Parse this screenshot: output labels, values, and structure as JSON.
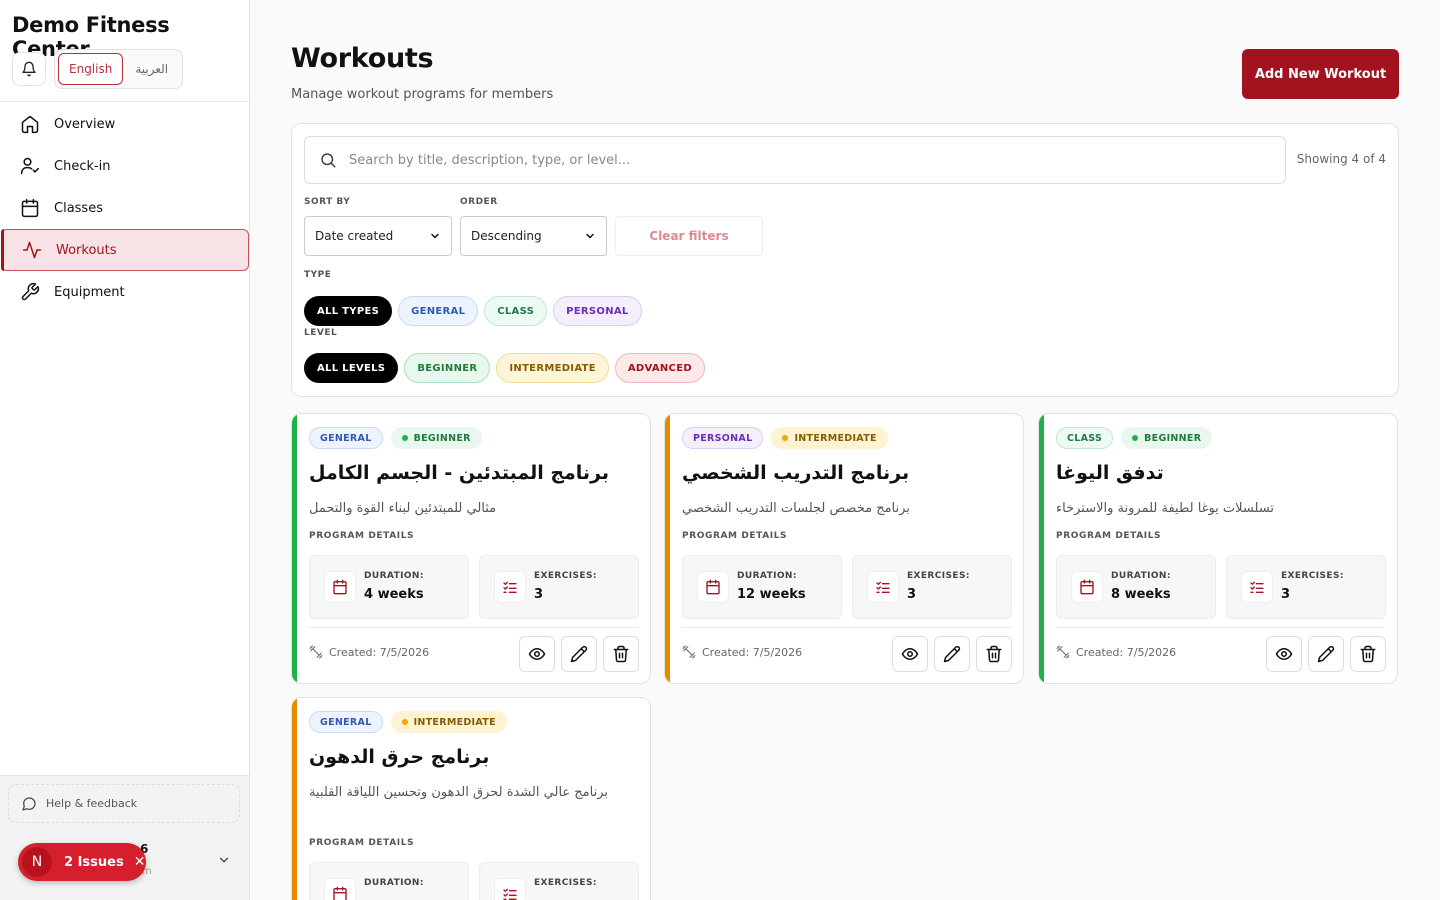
{
  "app": {
    "title": "Demo Fitness Center"
  },
  "lang": {
    "english": "English",
    "arabic": "العربية"
  },
  "nav": [
    {
      "label": "Overview",
      "icon": "home-icon"
    },
    {
      "label": "Check-in",
      "icon": "user-check-icon"
    },
    {
      "label": "Classes",
      "icon": "calendar-icon"
    },
    {
      "label": "Workouts",
      "icon": "activity-icon",
      "active": true
    },
    {
      "label": "Equipment",
      "icon": "wrench-icon"
    }
  ],
  "footer": {
    "help": "Help & feedback",
    "user_frag": "6",
    "user_sub": "ym"
  },
  "issues": {
    "letter": "N",
    "label": "2 Issues",
    "close": "✕"
  },
  "page": {
    "title": "Workouts",
    "subtitle": "Manage workout programs for members",
    "add_button": "Add New Workout"
  },
  "filters": {
    "search_placeholder": "Search by title, description, type, or level...",
    "showing": "Showing 4 of 4",
    "sort_label": "SORT BY",
    "sort_value": "Date created",
    "order_label": "ORDER",
    "order_value": "Descending",
    "clear": "Clear filters",
    "type_label": "TYPE",
    "types": [
      "ALL TYPES",
      "GENERAL",
      "CLASS",
      "PERSONAL"
    ],
    "level_label": "LEVEL",
    "levels": [
      "ALL LEVELS",
      "BEGINNER",
      "INTERMEDIATE",
      "ADVANCED"
    ]
  },
  "labels": {
    "program_details": "PROGRAM DETAILS",
    "duration": "DURATION:",
    "exercises": "EXERCISES:"
  },
  "workouts": [
    {
      "type": "GENERAL",
      "level": "BEGINNER",
      "title": "برنامج المبتدئين - الجسم الكامل",
      "description": "مثالي للمبتدئين لبناء القوة والتحمل",
      "duration": "4 weeks",
      "exercises": "3",
      "created": "Created: 7/5/2026"
    },
    {
      "type": "PERSONAL",
      "level": "INTERMEDIATE",
      "title": "برنامج التدريب الشخصي",
      "description": "برنامج مخصص لجلسات التدريب الشخصي",
      "duration": "12 weeks",
      "exercises": "3",
      "created": "Created: 7/5/2026"
    },
    {
      "type": "CLASS",
      "level": "BEGINNER",
      "title": "تدفق اليوغا",
      "description": "تسلسلات يوغا لطيفة للمرونة والاسترخاء",
      "duration": "8 weeks",
      "exercises": "3",
      "created": "Created: 7/5/2026"
    },
    {
      "type": "GENERAL",
      "level": "INTERMEDIATE",
      "title": "برنامج حرق الدهون",
      "description": "برنامج عالي الشدة لحرق الدهون وتحسين اللياقة القلبية",
      "duration": "",
      "exercises": "",
      "created": ""
    }
  ],
  "colors": {
    "accent": "#a3121f",
    "beginner": "#22b04b",
    "intermediate": "#e68a00"
  }
}
